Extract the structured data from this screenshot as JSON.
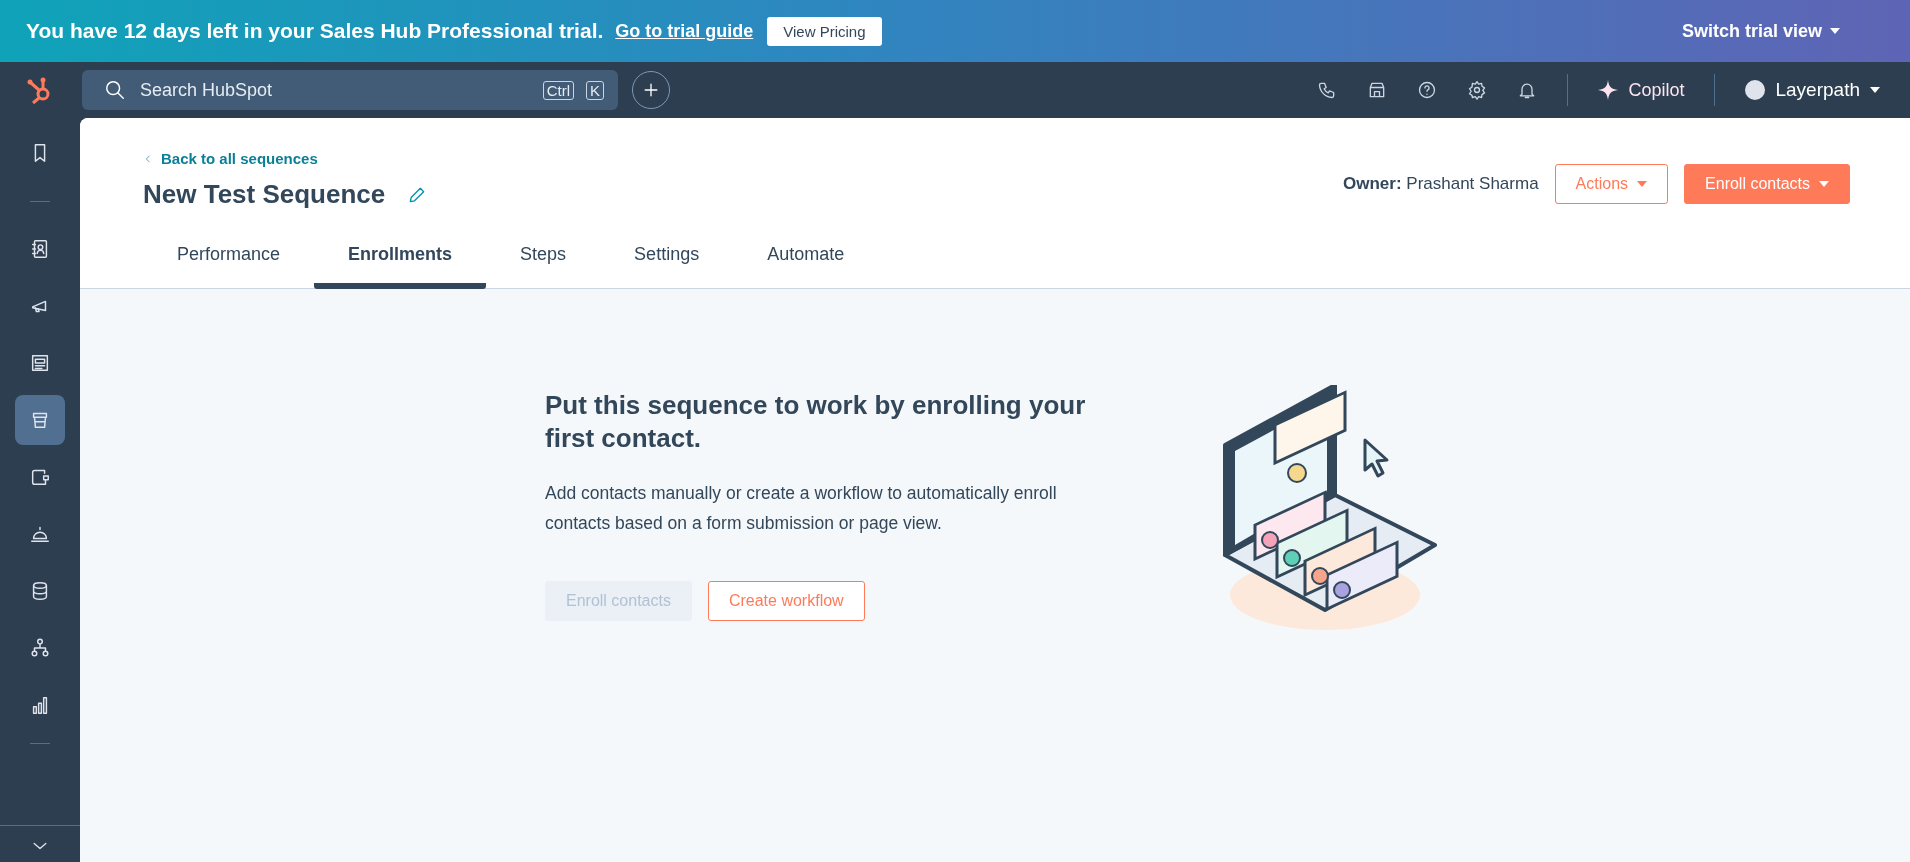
{
  "trial_banner": {
    "message": "You have 12 days left in your Sales Hub Professional trial.",
    "link": "Go to trial guide",
    "button": "View Pricing",
    "switch_view": "Switch trial view"
  },
  "top_nav": {
    "search": {
      "placeholder": "Search HubSpot",
      "shortcut_keys": [
        "Ctrl",
        "K"
      ]
    },
    "copilot": "Copilot",
    "account": "Layerpath"
  },
  "sidebar": {
    "items": [
      {
        "kind": "bookmark",
        "selected": false
      },
      {
        "kind": "contacts",
        "selected": false
      },
      {
        "kind": "marketing",
        "selected": false
      },
      {
        "kind": "content",
        "selected": false
      },
      {
        "kind": "sales",
        "selected": true
      },
      {
        "kind": "commerce",
        "selected": false
      },
      {
        "kind": "service",
        "selected": false
      },
      {
        "kind": "data",
        "selected": false
      },
      {
        "kind": "automation",
        "selected": false
      },
      {
        "kind": "reporting",
        "selected": false
      }
    ]
  },
  "header": {
    "back_link": "Back to all sequences",
    "title": "New Test Sequence",
    "owner_label": "Owner:",
    "owner_name": "Prashant Sharma",
    "actions_button": "Actions",
    "enroll_button": "Enroll contacts"
  },
  "tabs": [
    {
      "label": "Performance",
      "selected": false
    },
    {
      "label": "Enrollments",
      "selected": true
    },
    {
      "label": "Steps",
      "selected": false
    },
    {
      "label": "Settings",
      "selected": false
    },
    {
      "label": "Automate",
      "selected": false
    }
  ],
  "empty_state": {
    "heading": "Put this sequence to work by enrolling your first contact.",
    "description": "Add contacts manually or create a workflow to automatically enroll contacts based on a form submission or page view.",
    "buttons": [
      {
        "label": "Enroll contacts",
        "kind": "primary",
        "disabled": true
      },
      {
        "label": "Create workflow",
        "kind": "secondary",
        "disabled": false
      }
    ]
  }
}
